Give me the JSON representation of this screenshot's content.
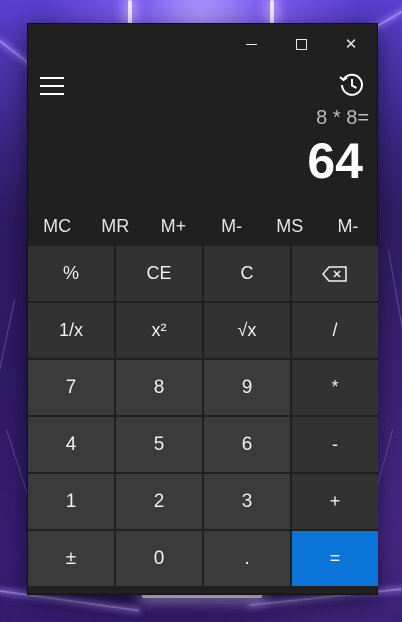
{
  "window": {
    "minimize_label": "—",
    "maximize_label": "☐",
    "close_label": "✕"
  },
  "display": {
    "expression": "8 * 8=",
    "result": "64"
  },
  "memory": [
    "MC",
    "MR",
    "M+",
    "M-",
    "MS",
    "M-"
  ],
  "keys": [
    [
      "%",
      "CE",
      "C",
      ""
    ],
    [
      "1/x",
      "x²",
      "√x",
      "/"
    ],
    [
      "7",
      "8",
      "9",
      "*"
    ],
    [
      "4",
      "5",
      "6",
      "-"
    ],
    [
      "1",
      "2",
      "3",
      "+"
    ],
    [
      "±",
      "0",
      ".",
      "="
    ]
  ],
  "icons": {
    "menu": "hamburger-menu-icon",
    "history": "history-icon",
    "backspace": "backspace-icon"
  },
  "colors": {
    "window_bg": "#202020",
    "key_bg": "#323232",
    "number_key_bg": "#3b3b3b",
    "equals_bg": "#0a74d8"
  }
}
